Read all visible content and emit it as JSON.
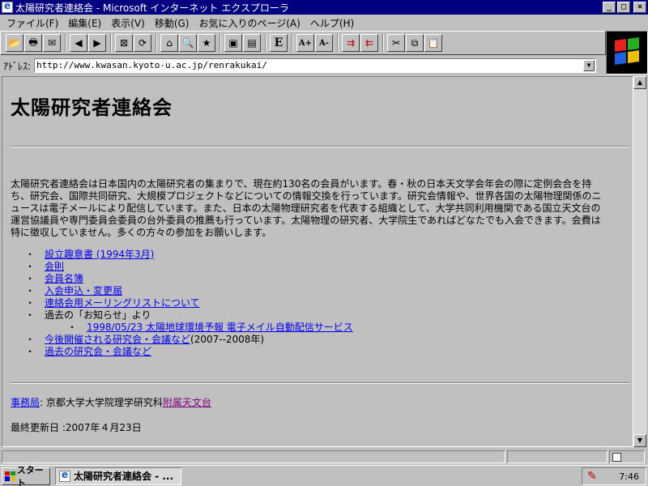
{
  "window": {
    "title": "太陽研究者連絡会 - Microsoft インターネット エクスプローラ",
    "minimize": "_",
    "maximize": "□",
    "close": "×"
  },
  "menu": {
    "items": [
      "ファイル(F)",
      "編集(E)",
      "表示(V)",
      "移動(G)",
      "お気に入りのページ(A)",
      "ヘルプ(H)"
    ]
  },
  "toolbar": {
    "buttons": [
      {
        "name": "open-icon",
        "glyph": "📂"
      },
      {
        "name": "print-icon",
        "glyph": "🖶"
      },
      {
        "name": "mail-icon",
        "glyph": "✉"
      },
      {
        "name": "back-icon",
        "glyph": "◀"
      },
      {
        "name": "forward-icon",
        "glyph": "▶"
      },
      {
        "name": "stop-icon",
        "glyph": "⊠"
      },
      {
        "name": "refresh-icon",
        "glyph": "⟳"
      },
      {
        "name": "home-icon",
        "glyph": "⌂"
      },
      {
        "name": "search-icon",
        "glyph": "🔍"
      },
      {
        "name": "favorites-icon",
        "glyph": "★"
      },
      {
        "name": "fullscreen-icon",
        "glyph": "▣"
      },
      {
        "name": "channels-icon",
        "glyph": "▤"
      },
      {
        "name": "edit-icon",
        "glyph": "E"
      },
      {
        "name": "font-larger-icon",
        "glyph": "A+"
      },
      {
        "name": "font-smaller-icon",
        "glyph": "A-"
      },
      {
        "name": "indent-icon",
        "glyph": "⇉"
      },
      {
        "name": "outdent-icon",
        "glyph": "⇇"
      },
      {
        "name": "cut-icon",
        "glyph": "✂"
      },
      {
        "name": "copy-icon",
        "glyph": "⧉"
      },
      {
        "name": "paste-icon",
        "glyph": "📋"
      }
    ]
  },
  "address": {
    "label": "ｱﾄﾞﾚｽ:",
    "url": "http://www.kwasan.kyoto-u.ac.jp/renrakukai/",
    "dropdown": "▼"
  },
  "page": {
    "heading": "太陽研究者連絡会",
    "intro": "太陽研究者連絡会は日本国内の太陽研究者の集まりで、現在約130名の会員がいます。春・秋の日本天文学会年会の際に定例会合を持ち、研究会、国際共同研究、大規模プロジェクトなどについての情報交換を行っています。研究会情報や、世界各国の太陽物理関係のニュースは電子メールにより配信しています。また、日本の太陽物理研究者を代表する組織として、大学共同利用機関である国立天文台の運営協議員や専門委員会委員の台外委員の推薦も行っています。太陽物理の研究者、大学院生であればどなたでも入会できます。会費は特に徴収していません。多くの方々の参加をお願いします。",
    "links": {
      "prospectus": "設立趣意書 (1994年3月)",
      "rules": "会則",
      "members": "会員名簿",
      "application": "入会申込・変更届",
      "mailinglist": "連絡会用メーリングリストについて",
      "past_news_label": "過去の「お知らせ」より",
      "past_news_item": "1998/05/23 太陽地球環境予報 電子メイル自動配信サービス",
      "upcoming": "今後開催される研究会・会議など",
      "upcoming_suffix": "(2007--2008年)",
      "past_meetings": "過去の研究会・会議など"
    },
    "office_label": "事務局",
    "office_sep": ": 京都大学大学院理学研究科",
    "office_link": "附属天文台",
    "updated": "最終更新日 :2007年４月23日"
  },
  "scrollbar": {
    "up": "▲",
    "down": "▼"
  },
  "taskbar": {
    "start": "スタート",
    "task_title": "太陽研究者連絡会 - ...",
    "clock": "7:46"
  },
  "colors": {
    "titlebar": "#000080",
    "link": "#0000ee",
    "visited": "#800080",
    "chrome": "#c0c0c0"
  }
}
